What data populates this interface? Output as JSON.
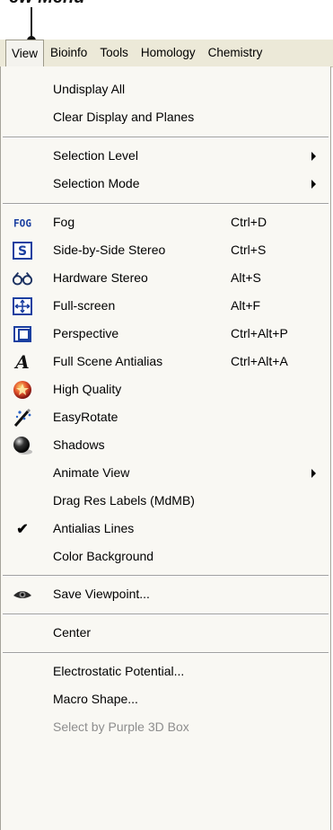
{
  "callout": {
    "text": "ew Menu"
  },
  "menubar": {
    "items": [
      "View",
      "Bioinfo",
      "Tools",
      "Homology",
      "Chemistry"
    ]
  },
  "menu": {
    "items": [
      {
        "label": "Undisplay All"
      },
      {
        "label": "Clear Display and Planes"
      },
      {
        "label": "Selection Level",
        "submenu": true
      },
      {
        "label": "Selection Mode",
        "submenu": true
      },
      {
        "label": "Fog",
        "shortcut": "Ctrl+D",
        "icon": "fog-icon",
        "icon_text": "FOG"
      },
      {
        "label": "Side-by-Side Stereo",
        "shortcut": "Ctrl+S",
        "icon": "stereo-s-icon",
        "icon_text": "S"
      },
      {
        "label": "Hardware Stereo",
        "shortcut": "Alt+S",
        "icon": "stereo-glasses-icon"
      },
      {
        "label": "Full-screen",
        "shortcut": "Alt+F",
        "icon": "fullscreen-icon"
      },
      {
        "label": "Perspective",
        "shortcut": "Ctrl+Alt+P",
        "icon": "perspective-icon"
      },
      {
        "label": "Full Scene Antialias",
        "shortcut": "Ctrl+Alt+A",
        "icon": "antialias-a-icon",
        "icon_text": "A"
      },
      {
        "label": "High Quality",
        "icon": "high-quality-icon"
      },
      {
        "label": "EasyRotate",
        "icon": "easyrotate-icon"
      },
      {
        "label": "Shadows",
        "icon": "shadow-sphere-icon"
      },
      {
        "label": "Animate View",
        "submenu": true
      },
      {
        "label": "Drag Res Labels (MdMB)"
      },
      {
        "label": "Antialias Lines",
        "checked": true,
        "check_glyph": "✔"
      },
      {
        "label": "Color Background"
      },
      {
        "label": "Save Viewpoint...",
        "icon": "eye-icon"
      },
      {
        "label": "Center"
      },
      {
        "label": "Electrostatic Potential..."
      },
      {
        "label": "Macro Shape..."
      },
      {
        "label": "Select by Purple 3D Box",
        "disabled": true
      }
    ]
  },
  "colors": {
    "menubar_bg": "#ece9d8",
    "menu_bg": "#f9f8f3",
    "disabled_text": "#8d8d8d",
    "icon_blue": "#1a3fa0",
    "icon_red": "#d2302c"
  }
}
